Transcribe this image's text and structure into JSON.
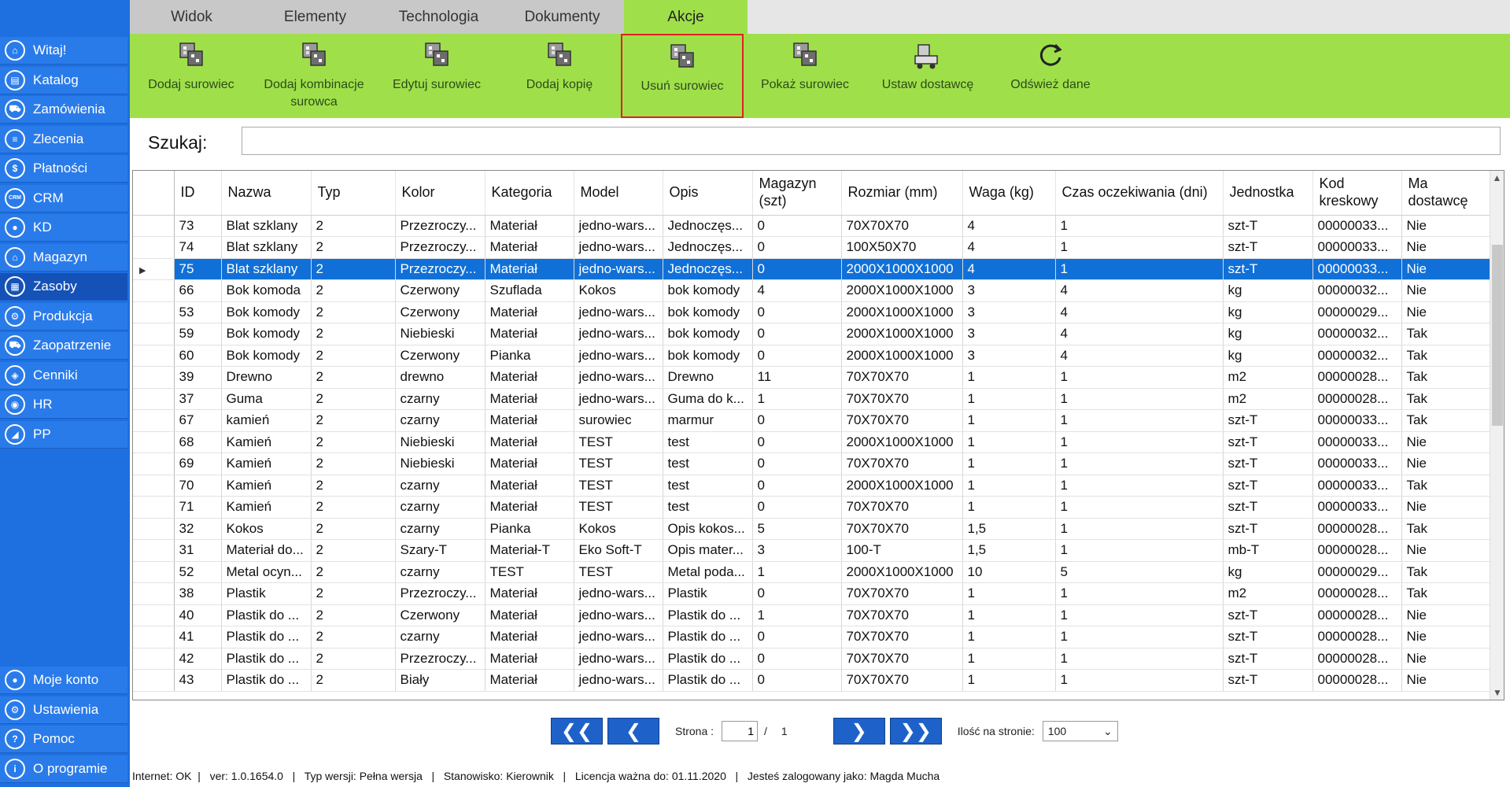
{
  "sidebar": {
    "items": [
      {
        "label": "Witaj!",
        "icon": "home-icon",
        "glyph": "⌂"
      },
      {
        "label": "Katalog",
        "icon": "book-icon",
        "glyph": "▤"
      },
      {
        "label": "Zamówienia",
        "icon": "cart-icon",
        "glyph": "⛟"
      },
      {
        "label": "Zlecenia",
        "icon": "list-icon",
        "glyph": "≡"
      },
      {
        "label": "Płatności",
        "icon": "dollar-icon",
        "glyph": "$"
      },
      {
        "label": "CRM",
        "icon": "crm-icon",
        "glyph": "CRM"
      },
      {
        "label": "KD",
        "icon": "user-icon",
        "glyph": "●"
      },
      {
        "label": "Magazyn",
        "icon": "warehouse-icon",
        "glyph": "⌂"
      },
      {
        "label": "Zasoby",
        "icon": "resources-icon",
        "glyph": "▦"
      },
      {
        "label": "Produkcja",
        "icon": "gear-icon",
        "glyph": "⚙"
      },
      {
        "label": "Zaopatrzenie",
        "icon": "truck-icon",
        "glyph": "⛟"
      },
      {
        "label": "Cenniki",
        "icon": "tag-icon",
        "glyph": "◈"
      },
      {
        "label": "HR",
        "icon": "hr-icon",
        "glyph": "◉"
      },
      {
        "label": "PP",
        "icon": "chart-icon",
        "glyph": "◢"
      }
    ],
    "bottom_items": [
      {
        "label": "Moje konto",
        "icon": "account-icon",
        "glyph": "●"
      },
      {
        "label": "Ustawienia",
        "icon": "settings-icon",
        "glyph": "⚙"
      },
      {
        "label": "Pomoc",
        "icon": "help-icon",
        "glyph": "?"
      },
      {
        "label": "O programie",
        "icon": "info-icon",
        "glyph": "i"
      }
    ],
    "active_label": "Zasoby"
  },
  "tabs": [
    "Widok",
    "Elementy",
    "Technologia",
    "Dokumenty",
    "Akcje"
  ],
  "active_tab": "Akcje",
  "ribbon": [
    {
      "label": "Dodaj surowiec",
      "icon": "add-material-icon"
    },
    {
      "label": "Dodaj kombinacje surowca",
      "icon": "add-combination-icon"
    },
    {
      "label": "Edytuj surowiec",
      "icon": "edit-material-icon"
    },
    {
      "label": "Dodaj kopię",
      "icon": "add-copy-icon"
    },
    {
      "label": "Usuń surowiec",
      "icon": "delete-material-icon",
      "highlighted": true
    },
    {
      "label": "Pokaż surowiec",
      "icon": "show-material-icon"
    },
    {
      "label": "Ustaw dostawcę",
      "icon": "set-supplier-icon"
    },
    {
      "label": "Odśwież dane",
      "icon": "refresh-icon"
    }
  ],
  "search": {
    "label": "Szukaj:",
    "value": ""
  },
  "grid": {
    "columns": [
      {
        "key": "id",
        "label": "ID",
        "w": 60
      },
      {
        "key": "nazwa",
        "label": "Nazwa",
        "w": 114
      },
      {
        "key": "typ",
        "label": "Typ",
        "w": 107
      },
      {
        "key": "kolor",
        "label": "Kolor",
        "w": 114
      },
      {
        "key": "kategoria",
        "label": "Kategoria",
        "w": 113
      },
      {
        "key": "model",
        "label": "Model",
        "w": 113
      },
      {
        "key": "opis",
        "label": "Opis",
        "w": 114
      },
      {
        "key": "magazyn",
        "label": "Magazyn (szt)",
        "w": 113
      },
      {
        "key": "rozmiar",
        "label": "Rozmiar (mm)",
        "w": 154
      },
      {
        "key": "waga",
        "label": "Waga (kg)",
        "w": 118
      },
      {
        "key": "czas",
        "label": "Czas oczekiwania (dni)",
        "w": 213
      },
      {
        "key": "jednostka",
        "label": "Jednostka",
        "w": 114
      },
      {
        "key": "kod",
        "label": "Kod kreskowy",
        "w": 113
      },
      {
        "key": "dostawca",
        "label": "Ma dostawcę",
        "w": 112
      }
    ],
    "selected_index": 2,
    "rows": [
      [
        "73",
        "Blat szklany",
        "2",
        "Przezroczy...",
        "Materiał",
        "jedno-wars...",
        "Jednoczęs...",
        "0",
        "70X70X70",
        "4",
        "1",
        "szt-T",
        "00000033...",
        "Nie"
      ],
      [
        "74",
        "Blat szklany",
        "2",
        "Przezroczy...",
        "Materiał",
        "jedno-wars...",
        "Jednoczęs...",
        "0",
        "100X50X70",
        "4",
        "1",
        "szt-T",
        "00000033...",
        "Nie"
      ],
      [
        "75",
        "Blat szklany",
        "2",
        "Przezroczy...",
        "Materiał",
        "jedno-wars...",
        "Jednoczęs...",
        "0",
        "2000X1000X1000",
        "4",
        "1",
        "szt-T",
        "00000033...",
        "Nie"
      ],
      [
        "66",
        "Bok komoda",
        "2",
        "Czerwony",
        "Szuflada",
        "Kokos",
        "bok komody",
        "4",
        "2000X1000X1000",
        "3",
        "4",
        "kg",
        "00000032...",
        "Nie"
      ],
      [
        "53",
        "Bok komody",
        "2",
        "Czerwony",
        "Materiał",
        "jedno-wars...",
        "bok komody",
        "0",
        "2000X1000X1000",
        "3",
        "4",
        "kg",
        "00000029...",
        "Nie"
      ],
      [
        "59",
        "Bok komody",
        "2",
        "Niebieski",
        "Materiał",
        "jedno-wars...",
        "bok komody",
        "0",
        "2000X1000X1000",
        "3",
        "4",
        "kg",
        "00000032...",
        "Tak"
      ],
      [
        "60",
        "Bok komody",
        "2",
        "Czerwony",
        "Pianka",
        "jedno-wars...",
        "bok komody",
        "0",
        "2000X1000X1000",
        "3",
        "4",
        "kg",
        "00000032...",
        "Tak"
      ],
      [
        "39",
        "Drewno",
        "2",
        "drewno",
        "Materiał",
        "jedno-wars...",
        "Drewno",
        "11",
        "70X70X70",
        "1",
        "1",
        "m2",
        "00000028...",
        "Tak"
      ],
      [
        "37",
        "Guma",
        "2",
        "czarny",
        "Materiał",
        "jedno-wars...",
        "Guma do k...",
        "1",
        "70X70X70",
        "1",
        "1",
        "m2",
        "00000028...",
        "Tak"
      ],
      [
        "67",
        "kamień",
        "2",
        "czarny",
        "Materiał",
        "surowiec",
        "marmur",
        "0",
        "70X70X70",
        "1",
        "1",
        "szt-T",
        "00000033...",
        "Tak"
      ],
      [
        "68",
        "Kamień",
        "2",
        "Niebieski",
        "Materiał",
        "TEST",
        "test",
        "0",
        "2000X1000X1000",
        "1",
        "1",
        "szt-T",
        "00000033...",
        "Nie"
      ],
      [
        "69",
        "Kamień",
        "2",
        "Niebieski",
        "Materiał",
        "TEST",
        "test",
        "0",
        "70X70X70",
        "1",
        "1",
        "szt-T",
        "00000033...",
        "Nie"
      ],
      [
        "70",
        "Kamień",
        "2",
        "czarny",
        "Materiał",
        "TEST",
        "test",
        "0",
        "2000X1000X1000",
        "1",
        "1",
        "szt-T",
        "00000033...",
        "Tak"
      ],
      [
        "71",
        "Kamień",
        "2",
        "czarny",
        "Materiał",
        "TEST",
        "test",
        "0",
        "70X70X70",
        "1",
        "1",
        "szt-T",
        "00000033...",
        "Nie"
      ],
      [
        "32",
        "Kokos",
        "2",
        "czarny",
        "Pianka",
        "Kokos",
        "Opis kokos...",
        "5",
        "70X70X70",
        "1,5",
        "1",
        "szt-T",
        "00000028...",
        "Tak"
      ],
      [
        "31",
        "Materiał do...",
        "2",
        "Szary-T",
        "Materiał-T",
        "Eko Soft-T",
        "Opis mater...",
        "3",
        "100-T",
        "1,5",
        "1",
        "mb-T",
        "00000028...",
        "Nie"
      ],
      [
        "52",
        "Metal ocyn...",
        "2",
        "czarny",
        "TEST",
        "TEST",
        "Metal poda...",
        "1",
        "2000X1000X1000",
        "10",
        "5",
        "kg",
        "00000029...",
        "Tak"
      ],
      [
        "38",
        "Plastik",
        "2",
        "Przezroczy...",
        "Materiał",
        "jedno-wars...",
        "Plastik",
        "0",
        "70X70X70",
        "1",
        "1",
        "m2",
        "00000028...",
        "Tak"
      ],
      [
        "40",
        "Plastik do ...",
        "2",
        "Czerwony",
        "Materiał",
        "jedno-wars...",
        "Plastik do ...",
        "1",
        "70X70X70",
        "1",
        "1",
        "szt-T",
        "00000028...",
        "Nie"
      ],
      [
        "41",
        "Plastik do ...",
        "2",
        "czarny",
        "Materiał",
        "jedno-wars...",
        "Plastik do ...",
        "0",
        "70X70X70",
        "1",
        "1",
        "szt-T",
        "00000028...",
        "Nie"
      ],
      [
        "42",
        "Plastik do ...",
        "2",
        "Przezroczy...",
        "Materiał",
        "jedno-wars...",
        "Plastik do ...",
        "0",
        "70X70X70",
        "1",
        "1",
        "szt-T",
        "00000028...",
        "Nie"
      ],
      [
        "43",
        "Plastik do ...",
        "2",
        "Biały",
        "Materiał",
        "jedno-wars...",
        "Plastik do ...",
        "0",
        "70X70X70",
        "1",
        "1",
        "szt-T",
        "00000028...",
        "Nie"
      ]
    ]
  },
  "pager": {
    "first": "❮❮",
    "prev": "❮",
    "next": "❯",
    "last": "❯❯",
    "page_label": "Strona :",
    "page": "1",
    "sep": "/",
    "total": "1",
    "per_page_label": "Ilość na stronie:",
    "per_page": "100"
  },
  "status": {
    "text": "Internet: OK  |   ver: 1.0.1654.0   |   Typ wersji: Pełna wersja   |   Stanowisko: Kierownik   |   Licencja ważna do: 01.11.2020   |   Jesteś zalogowany jako: Magda Mucha"
  },
  "colors": {
    "sidebar": "#1e6fe0",
    "ribbon": "#9fe04a",
    "selection": "#1070d8",
    "highlight": "#e02020"
  }
}
